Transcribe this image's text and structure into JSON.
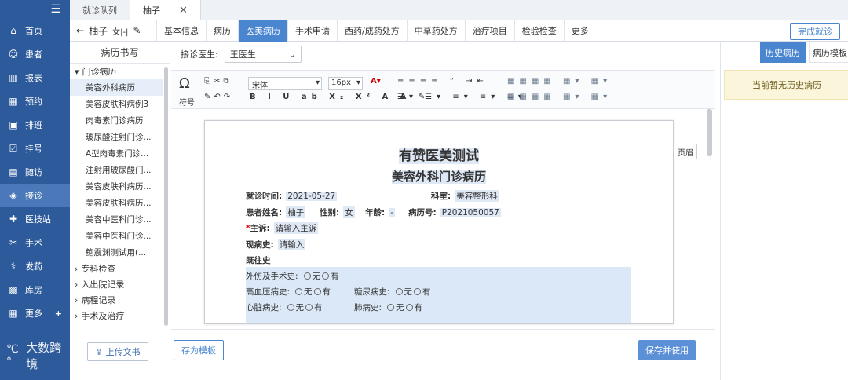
{
  "sidebar": {
    "items": [
      {
        "icon": "home-icon",
        "label": "首页"
      },
      {
        "icon": "patients-icon",
        "label": "患者"
      },
      {
        "icon": "report-icon",
        "label": "报表"
      },
      {
        "icon": "calendar-icon",
        "label": "预约"
      },
      {
        "icon": "schedule-icon",
        "label": "排班"
      },
      {
        "icon": "register-icon",
        "label": "挂号"
      },
      {
        "icon": "followup-icon",
        "label": "随访"
      },
      {
        "icon": "reception-icon",
        "label": "接诊"
      },
      {
        "icon": "clinic-icon",
        "label": "医技站"
      },
      {
        "icon": "surgery-icon",
        "label": "手术"
      },
      {
        "icon": "medicine-icon",
        "label": "发药"
      },
      {
        "icon": "warehouse-icon",
        "label": "库房"
      },
      {
        "icon": "more-icon",
        "label": "更多"
      }
    ],
    "logo_text": "大数跨境"
  },
  "tabs": [
    "就诊队列",
    "柚子"
  ],
  "patient": {
    "name": "柚子",
    "gender": "女|-|"
  },
  "record_tabs": [
    "基本信息",
    "病历",
    "医美病历",
    "手术申请",
    "西药/成药处方",
    "中草药处方",
    "治疗项目",
    "检验检查",
    "更多"
  ],
  "complete_button": "完成就诊",
  "left_panel": {
    "title": "病历书写",
    "group1": "门诊病历",
    "leaves": [
      "美容外科病历",
      "美容皮肤科病例3",
      "肉毒素门诊病历",
      "玻尿酸注射门诊...",
      "A型肉毒素门诊...",
      "注射用玻尿酸门...",
      "美容皮肤科病历...",
      "美容皮肤科病历...",
      "美容中医科门诊...",
      "美容中医科门诊...",
      "鲍震渊测试用(..."
    ],
    "groups": [
      "专科检查",
      "入出院记录",
      "病程记录",
      "手术及治疗"
    ],
    "upload": "上传文书"
  },
  "editor": {
    "doctor_label": "接诊医生:",
    "doctor": "王医生",
    "symbol": "符号",
    "font": "宋体",
    "size": "16px",
    "page_button": "页眉",
    "save_template": "存为模板",
    "save_use": "保存并使用"
  },
  "doc": {
    "title": "有赞医美测试",
    "subtitle": "美容外科门诊病历",
    "visit_time_label": "就诊时间:",
    "visit_time": "2021-05-27",
    "dept_label": "科室:",
    "dept": "美容整形科",
    "name_label": "患者姓名:",
    "name": "柚子",
    "sex_label": "性别:",
    "sex": "女",
    "age_label": "年龄:",
    "age": "-",
    "record_label": "病历号:",
    "record_no": "P2021050057",
    "complaint_label": "主诉:",
    "complaint_ph": "请输入主诉",
    "present_label": "现病史:",
    "present_ph": "请输入",
    "history_label": "既往史",
    "trauma": "外伤及手术史:",
    "hypertension": "高血压病史:",
    "diabetes": "糖尿病史:",
    "heart": "心脏病史:",
    "lung": "肺病史:",
    "no": "无",
    "yes": "有"
  },
  "right": {
    "tab1": "历史病历",
    "tab2": "病历模板",
    "notice": "当前暂无历史病历"
  }
}
